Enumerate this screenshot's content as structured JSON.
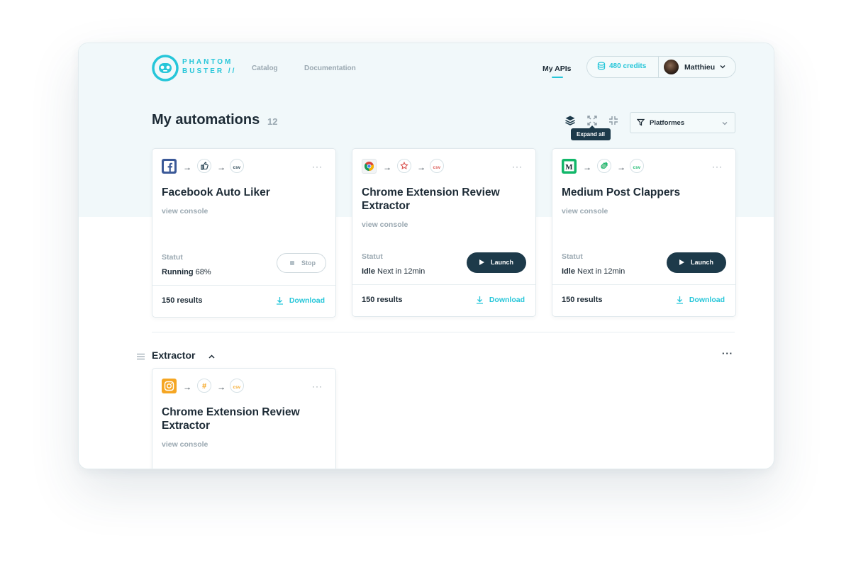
{
  "header": {
    "brand_line1": "PHANTOM",
    "brand_line2": "BUSTER //",
    "nav": [
      "Catalog",
      "Documentation"
    ],
    "active_nav": "My APIs",
    "credits": "480 credits",
    "user_name": "Matthieu"
  },
  "toolbar": {
    "title": "My automations",
    "count": "12",
    "tooltip": "Expand all",
    "filter_label": "Platformes"
  },
  "cards": [
    {
      "title": "Facebook Auto Liker",
      "console_link": "view console",
      "statut_label": "Statut",
      "status": "Running",
      "status_detail": "68%",
      "progress": 0.68,
      "action": "Stop",
      "results": "150 results",
      "download": "Download",
      "csv": "csv"
    },
    {
      "title": "Chrome Extension Review Extractor",
      "console_link": "view console",
      "statut_label": "Statut",
      "status": "Idle",
      "status_detail": "Next in 12min",
      "action": "Launch",
      "results": "150 results",
      "download": "Download",
      "csv": "csv"
    },
    {
      "title": "Medium Post Clappers",
      "console_link": "view console",
      "statut_label": "Statut",
      "status": "Idle",
      "status_detail": "Next in 12min",
      "action": "Launch",
      "results": "150 results",
      "download": "Download",
      "csv": "csv"
    }
  ],
  "section": {
    "title": "Extractor",
    "more": "···",
    "card": {
      "title": "Chrome Extension Review Extractor",
      "console_link": "view console",
      "csv": "csv"
    }
  },
  "colors": {
    "accent": "#26c6d9",
    "dark_button": "#1d3a4a",
    "band": "#f1f8fa",
    "facebook": "#3b5998",
    "medium": "#12b76a",
    "instagram": "#f5a623"
  }
}
